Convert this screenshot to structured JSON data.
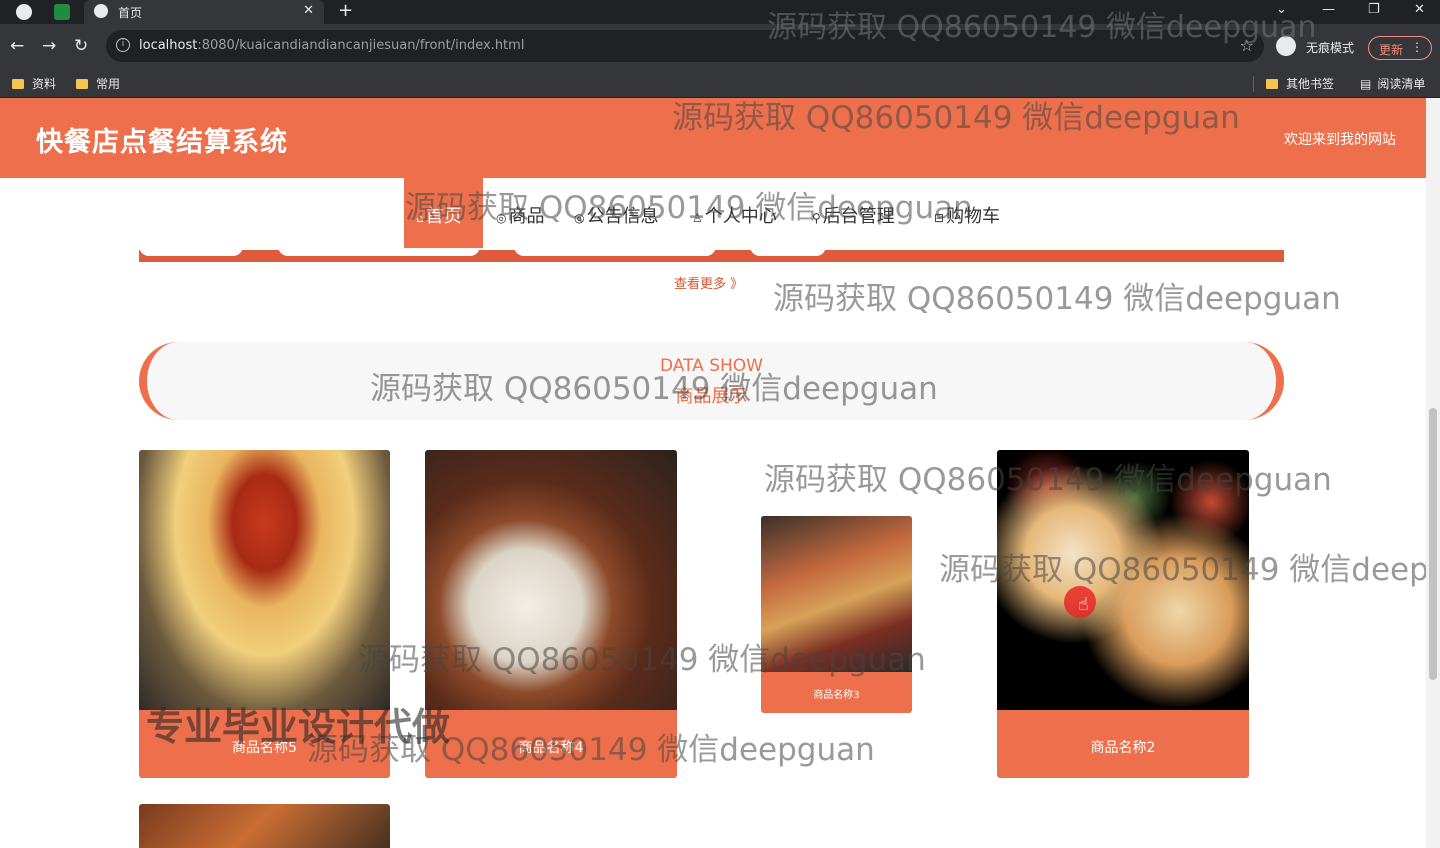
{
  "browser": {
    "tab_title": "首页",
    "url_host": "localhost",
    "url_path": ":8080/kuaicandiandiancanjiesuan/front/index.html",
    "incognito_label": "无痕模式",
    "update_label": "更新",
    "bookmarks": [
      "资料",
      "常用"
    ],
    "other_bookmarks": "其他书签",
    "reading_list": "阅读清单"
  },
  "site": {
    "title": "快餐店点餐结算系统",
    "welcome": "欢迎来到我的网站"
  },
  "nav": {
    "items": [
      {
        "label": "首页",
        "icon": "home-icon"
      },
      {
        "label": "商品",
        "icon": "goods-icon"
      },
      {
        "label": "公告信息",
        "icon": "notice-icon"
      },
      {
        "label": "个人中心",
        "icon": "user-icon"
      },
      {
        "label": "后台管理",
        "icon": "link-icon"
      },
      {
        "label": "购物车",
        "icon": "cart-icon"
      }
    ]
  },
  "more": "查看更多 》",
  "section": {
    "title_en": "DATA SHOW",
    "title_cn": "商品展示"
  },
  "products": [
    {
      "name": "商品名称5"
    },
    {
      "name": "商品名称4"
    },
    {
      "name": "商品名称3"
    },
    {
      "name": "商品名称2"
    }
  ],
  "watermark": "源码获取 QQ86050149 微信deepguan",
  "watermark_partial": "源码获取 QQ86050149 微信deepgu",
  "watermark_big": "专业毕业设计代做",
  "colors": {
    "accent": "#ee6f4b",
    "strip": "#e05a3c"
  }
}
